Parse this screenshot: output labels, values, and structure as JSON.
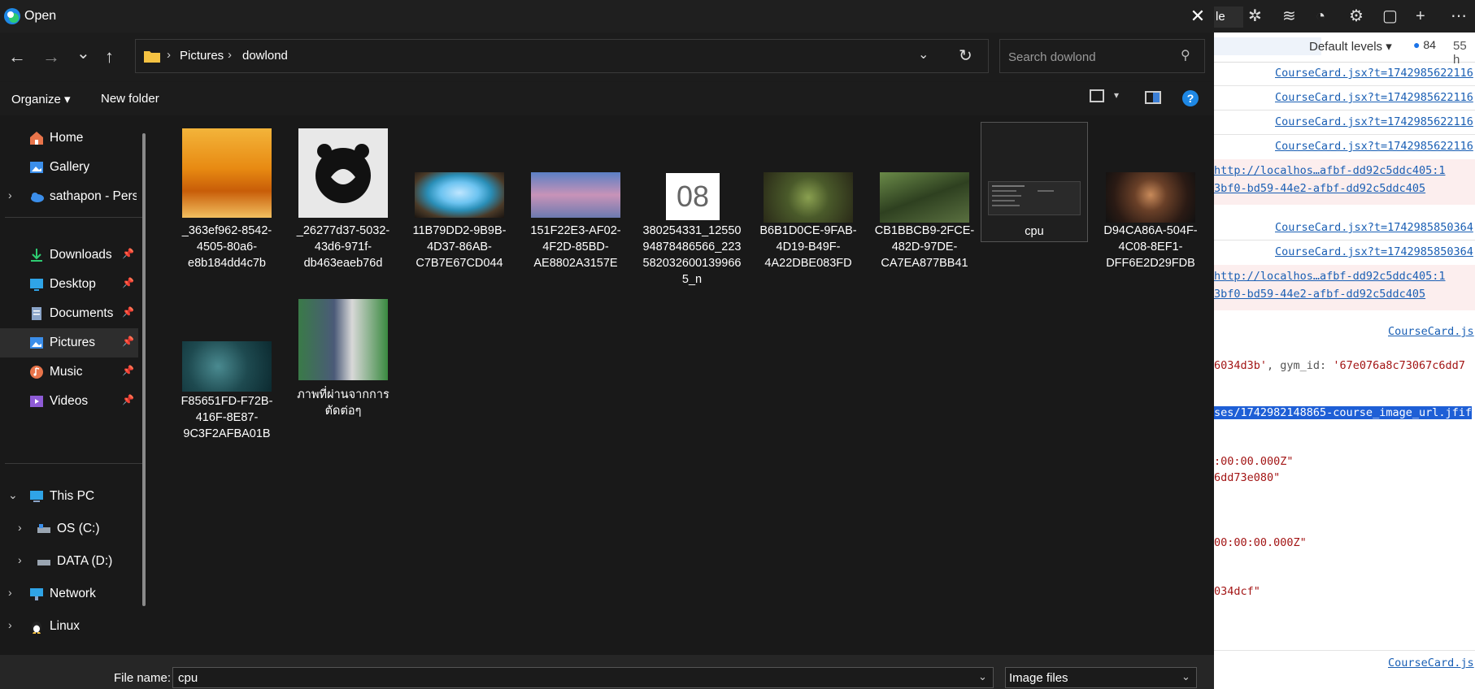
{
  "dialog": {
    "title": "Open",
    "close_glyph": "✕"
  },
  "nav": {
    "back_glyph": "←",
    "forward_glyph": "→",
    "recent_glyph": "⌄",
    "up_glyph": "↑"
  },
  "address": {
    "crumbs": [
      "Pictures",
      "dowlond"
    ],
    "separator": "›",
    "dropdown_glyph": "⌄",
    "refresh_glyph": "↻"
  },
  "search": {
    "placeholder": "Search dowlond",
    "icon_glyph": "⚲"
  },
  "toolbar": {
    "organize_label": "Organize ▾",
    "newfolder_label": "New folder",
    "view_dd_glyph": "▾",
    "help_glyph": "?"
  },
  "sidebar": {
    "items": [
      {
        "label": "Home"
      },
      {
        "label": "Gallery"
      },
      {
        "label": "sathapon - Personal"
      },
      {
        "label": "Downloads"
      },
      {
        "label": "Desktop"
      },
      {
        "label": "Documents"
      },
      {
        "label": "Pictures"
      },
      {
        "label": "Music"
      },
      {
        "label": "Videos"
      },
      {
        "label": "This PC"
      },
      {
        "label": "OS (C:)"
      },
      {
        "label": "DATA (D:)"
      },
      {
        "label": "Network"
      },
      {
        "label": "Linux"
      }
    ],
    "pin_glyph": "📌",
    "chevron_right": "›",
    "chevron_down": "⌄"
  },
  "files": [
    {
      "name": "_363ef962-8542-4505-80a6-e8b184dd4c7b"
    },
    {
      "name": "_26277d37-5032-43d6-971f-db463eaeb76d"
    },
    {
      "name": "11B79DD2-9B9B-4D37-86AB-C7B7E67CD044"
    },
    {
      "name": "151F22E3-AF02-4F2D-85BD-AE8802A3157E"
    },
    {
      "name": "380254331_1255094878486566_2235820326001399665_n",
      "thumb_text": "08"
    },
    {
      "name": "B6B1D0CE-9FAB-4D19-B49F-4A22DBE083FD"
    },
    {
      "name": "CB1BBCB9-2FCE-482D-97DE-CA7EA877BB41"
    },
    {
      "name": "cpu"
    },
    {
      "name": "D94CA86A-504F-4C08-8EF1-DFF6E2D29FDB"
    },
    {
      "name": "F85651FD-F72B-416F-8E87-9C3F2AFBA01B"
    },
    {
      "name": "ภาพที่ผ่านจากการตัดต่อๆ"
    }
  ],
  "bottom": {
    "filename_label": "File name:",
    "filename_value": "cpu",
    "filetype_value": "Image files",
    "dropdown_glyph": "⌄"
  },
  "devtools": {
    "tab_label": "le",
    "levels_label": "Default levels ▾",
    "message_count": "84",
    "hidden_count": "55 h",
    "rows": [
      {
        "text": "CourseCard.jsx?t=1742985622116"
      },
      {
        "text": "CourseCard.jsx?t=1742985622116"
      },
      {
        "text": "CourseCard.jsx?t=1742985622116"
      },
      {
        "text": "CourseCard.jsx?t=1742985622116"
      },
      {
        "text": "http://localhos…afbf-dd92c5ddc405:1"
      },
      {
        "text": "3bf0-bd59-44e2-afbf-dd92c5ddc405"
      },
      {
        "text": "CourseCard.jsx?t=1742985850364"
      },
      {
        "text": "CourseCard.jsx?t=1742985850364"
      },
      {
        "text": "http://localhos…afbf-dd92c5ddc405:1"
      },
      {
        "text": "3bf0-bd59-44e2-afbf-dd92c5ddc405"
      },
      {
        "text": "CourseCard.js"
      },
      {
        "text_a": "6034d3b'",
        "text_b": ", gym_id: ",
        "text_c": "'67e076a8c73067c6dd7"
      },
      {
        "text": "ses/1742982148865-course_image_url.jfif"
      },
      {
        "text": ":00:00.000Z\""
      },
      {
        "text": "6dd73e080\""
      },
      {
        "text": "00:00:00.000Z\""
      },
      {
        "text": "034dcf\""
      },
      {
        "text": "CourseCard.js"
      }
    ]
  }
}
